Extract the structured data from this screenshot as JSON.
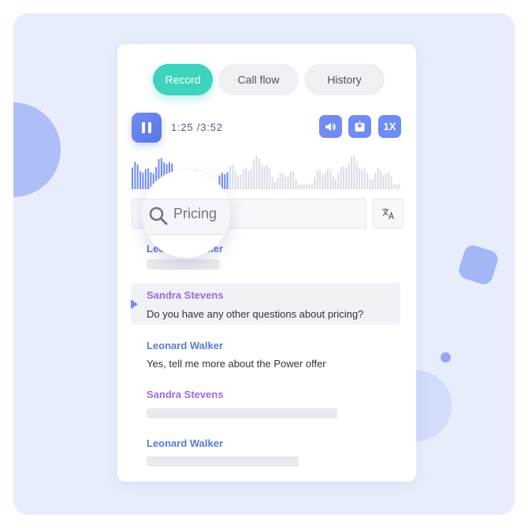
{
  "tabs": [
    {
      "label": "Record",
      "active": true
    },
    {
      "label": "Call flow",
      "active": false
    },
    {
      "label": "History",
      "active": false
    }
  ],
  "player": {
    "time": "1:25 /3:52",
    "progress_fraction": 0.366,
    "speed_label": "1X",
    "icons": [
      "pause-icon",
      "volume-icon",
      "download-icon",
      "translate-icon",
      "search-icon"
    ]
  },
  "search": {
    "value": "Pricing"
  },
  "transcript": [
    {
      "speaker": "Leonard Walker",
      "text": null
    },
    {
      "speaker": "Sandra Stevens",
      "text": "Do you have any other questions about pricing?",
      "highlighted": true
    },
    {
      "speaker": "Leonard Walker",
      "text": "Yes, tell me more about the Power offer"
    },
    {
      "speaker": "Sandra Stevens",
      "text": null
    },
    {
      "speaker": "Leonard Walker",
      "text": null
    }
  ],
  "colors": {
    "accent": "#3ed3bd",
    "primary": "#6f8cf3",
    "speaker_a": "#5b78d6",
    "speaker_b": "#9a6bd6"
  }
}
